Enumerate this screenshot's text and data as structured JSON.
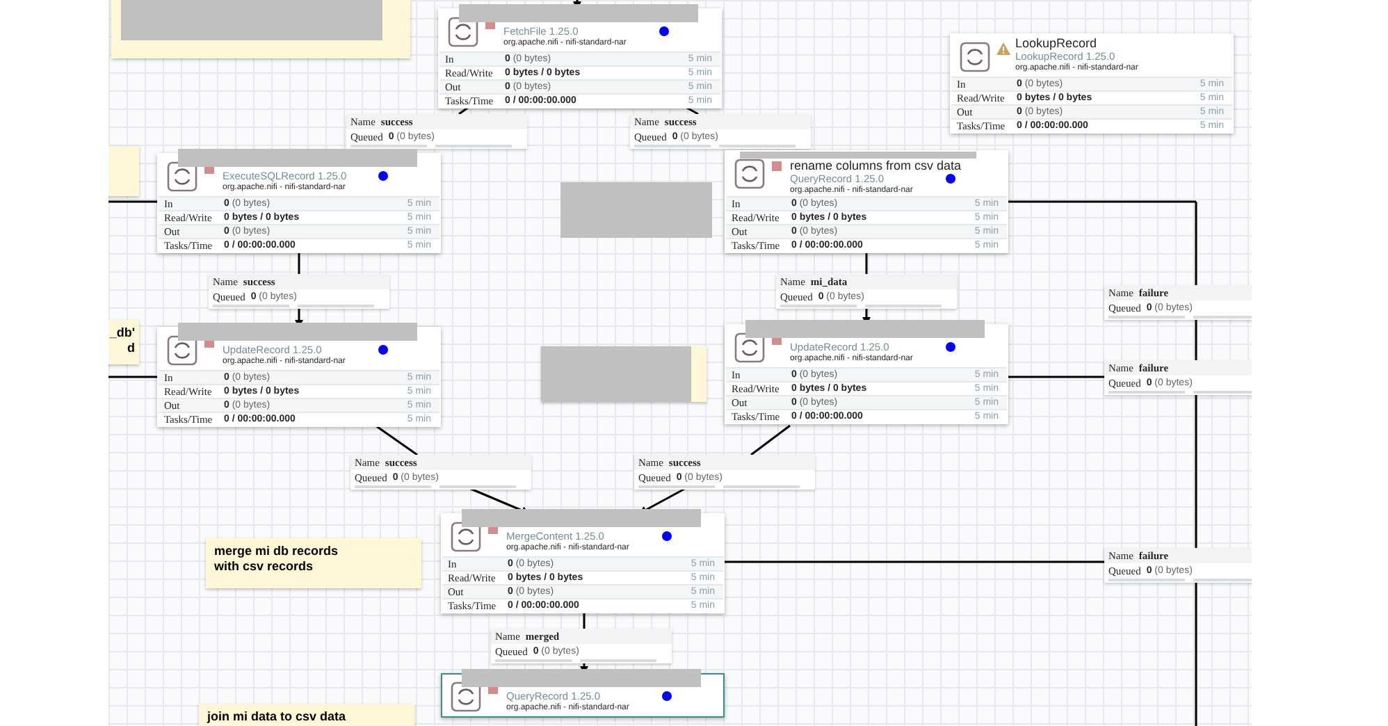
{
  "processors": [
    {
      "name_redacted": true,
      "type": "FetchFile 1.25.0",
      "bundle": "org.apache.nifi - nifi-standard-nar",
      "stopped": true,
      "warning": false,
      "flagged": true,
      "selected": false,
      "stats": [
        {
          "label": "In",
          "value": "**0** (0 bytes)",
          "kind": "count",
          "time": "5 min"
        },
        {
          "label": "Read/Write",
          "value": "0 bytes / 0 bytes",
          "kind": "total",
          "time": "5 min"
        },
        {
          "label": "Out",
          "value": "**0** (0 bytes)",
          "kind": "count",
          "time": "5 min"
        },
        {
          "label": "Tasks/Time",
          "value": "0 / 00:00:00.000",
          "kind": "total",
          "time": "5 min"
        }
      ]
    },
    {
      "name": "LookupRecord",
      "name_redacted": false,
      "type": "LookupRecord 1.25.0",
      "bundle": "org.apache.nifi - nifi-standard-nar",
      "stopped": false,
      "warning": true,
      "flagged": false,
      "selected": false,
      "stats": [
        {
          "label": "In",
          "value": "**0** (0 bytes)",
          "kind": "count",
          "time": "5 min"
        },
        {
          "label": "Read/Write",
          "value": "0 bytes / 0 bytes",
          "kind": "total",
          "time": "5 min"
        },
        {
          "label": "Out",
          "value": "**0** (0 bytes)",
          "kind": "count",
          "time": "5 min"
        },
        {
          "label": "Tasks/Time",
          "value": "0 / 00:00:00.000",
          "kind": "total",
          "time": "5 min"
        }
      ]
    },
    {
      "name_redacted": true,
      "type": "ExecuteSQLRecord 1.25.0",
      "bundle": "org.apache.nifi - nifi-standard-nar",
      "stopped": true,
      "warning": false,
      "flagged": true,
      "selected": false,
      "stats": [
        {
          "label": "In",
          "value": "**0** (0 bytes)",
          "kind": "count",
          "time": "5 min"
        },
        {
          "label": "Read/Write",
          "value": "0 bytes / 0 bytes",
          "kind": "total",
          "time": "5 min"
        },
        {
          "label": "Out",
          "value": "**0** (0 bytes)",
          "kind": "count",
          "time": "5 min"
        },
        {
          "label": "Tasks/Time",
          "value": "0 / 00:00:00.000",
          "kind": "total",
          "time": "5 min"
        }
      ]
    },
    {
      "name": "rename columns from csv data",
      "name_redacted": true,
      "type": "QueryRecord 1.25.0",
      "bundle": "org.apache.nifi - nifi-standard-nar",
      "stopped": true,
      "warning": false,
      "flagged": true,
      "selected": false,
      "stats": [
        {
          "label": "In",
          "value": "**0** (0 bytes)",
          "kind": "count",
          "time": "5 min"
        },
        {
          "label": "Read/Write",
          "value": "0 bytes / 0 bytes",
          "kind": "total",
          "time": "5 min"
        },
        {
          "label": "Out",
          "value": "**0** (0 bytes)",
          "kind": "count",
          "time": "5 min"
        },
        {
          "label": "Tasks/Time",
          "value": "0 / 00:00:00.000",
          "kind": "total",
          "time": "5 min"
        }
      ]
    },
    {
      "name_redacted": true,
      "type": "UpdateRecord 1.25.0",
      "bundle": "org.apache.nifi - nifi-standard-nar",
      "stopped": true,
      "warning": false,
      "flagged": true,
      "selected": false,
      "stats": [
        {
          "label": "In",
          "value": "**0** (0 bytes)",
          "kind": "count",
          "time": "5 min"
        },
        {
          "label": "Read/Write",
          "value": "0 bytes / 0 bytes",
          "kind": "total",
          "time": "5 min"
        },
        {
          "label": "Out",
          "value": "**0** (0 bytes)",
          "kind": "count",
          "time": "5 min"
        },
        {
          "label": "Tasks/Time",
          "value": "0 / 00:00:00.000",
          "kind": "total",
          "time": "5 min"
        }
      ]
    },
    {
      "name_redacted": true,
      "type": "UpdateRecord 1.25.0",
      "bundle": "org.apache.nifi - nifi-standard-nar",
      "stopped": true,
      "warning": false,
      "flagged": true,
      "selected": false,
      "stats": [
        {
          "label": "In",
          "value": "**0** (0 bytes)",
          "kind": "count",
          "time": "5 min"
        },
        {
          "label": "Read/Write",
          "value": "0 bytes / 0 bytes",
          "kind": "total",
          "time": "5 min"
        },
        {
          "label": "Out",
          "value": "**0** (0 bytes)",
          "kind": "count",
          "time": "5 min"
        },
        {
          "label": "Tasks/Time",
          "value": "0 / 00:00:00.000",
          "kind": "total",
          "time": "5 min"
        }
      ]
    },
    {
      "name_redacted": true,
      "type": "MergeContent 1.25.0",
      "bundle": "org.apache.nifi - nifi-standard-nar",
      "stopped": true,
      "warning": false,
      "flagged": true,
      "selected": false,
      "stats": [
        {
          "label": "In",
          "value": "**0** (0 bytes)",
          "kind": "count",
          "time": "5 min"
        },
        {
          "label": "Read/Write",
          "value": "0 bytes / 0 bytes",
          "kind": "total",
          "time": "5 min"
        },
        {
          "label": "Out",
          "value": "**0** (0 bytes)",
          "kind": "count",
          "time": "5 min"
        },
        {
          "label": "Tasks/Time",
          "value": "0 / 00:00:00.000",
          "kind": "total",
          "time": "5 min"
        }
      ]
    },
    {
      "name_redacted": true,
      "type": "QueryRecord 1.25.0",
      "bundle": "org.apache.nifi - nifi-standard-nar",
      "stopped": true,
      "warning": false,
      "flagged": true,
      "selected": true
    }
  ],
  "connections": [
    {
      "name_label": "Name",
      "name": "success",
      "queued_label": "Queued",
      "queued": "**0** (0 bytes)"
    },
    {
      "name_label": "Name",
      "name": "success",
      "queued_label": "Queued",
      "queued": "**0** (0 bytes)"
    },
    {
      "name_label": "Name",
      "name": "success",
      "queued_label": "Queued",
      "queued": "**0** (0 bytes)"
    },
    {
      "name_label": "Name",
      "name": "mi_data",
      "queued_label": "Queued",
      "queued": "**0** (0 bytes)"
    },
    {
      "name_label": "Name",
      "name": "failure",
      "queued_label": "Queued",
      "queued": "**0** (0 bytes)"
    },
    {
      "name_label": "Name",
      "name": "failure",
      "queued_label": "Queued",
      "queued": "**0** (0 bytes)"
    },
    {
      "name_label": "Name",
      "name": "success",
      "queued_label": "Queued",
      "queued": "**0** (0 bytes)"
    },
    {
      "name_label": "Name",
      "name": "success",
      "queued_label": "Queued",
      "queued": "**0** (0 bytes)"
    },
    {
      "name_label": "Name",
      "name": "failure",
      "queued_label": "Queued",
      "queued": "**0** (0 bytes)"
    },
    {
      "name_label": "Name",
      "name": "merged",
      "queued_label": "Queued",
      "queued": "**0** (0 bytes)"
    }
  ],
  "notes": [
    {
      "redacted": true
    },
    {
      "redacted": false
    },
    {
      "text": "_db'\nd",
      "redacted": false
    },
    {
      "redacted": true
    },
    {
      "text": "merge mi db records\nwith csv records",
      "redacted": false
    },
    {
      "text": "join mi data to csv data",
      "redacted": false
    }
  ]
}
